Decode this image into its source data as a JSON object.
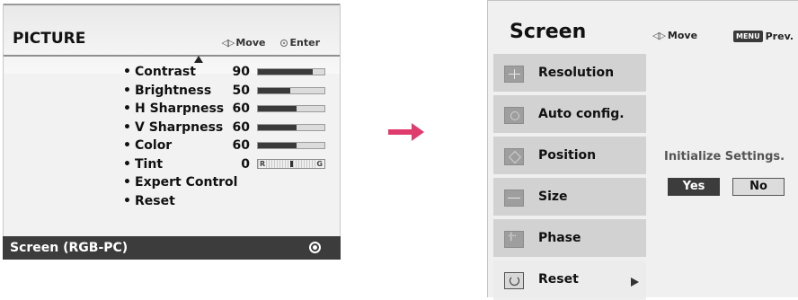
{
  "picture_menu": {
    "title": "PICTURE",
    "move_label": "Move",
    "enter_label": "Enter",
    "items": [
      {
        "label": "Contrast",
        "value": "90",
        "level": 0.82,
        "kind": "bar"
      },
      {
        "label": "Brightness",
        "value": "50",
        "level": 0.48,
        "kind": "bar"
      },
      {
        "label": "H Sharpness",
        "value": "60",
        "level": 0.58,
        "kind": "bar"
      },
      {
        "label": "V Sharpness",
        "value": "60",
        "level": 0.58,
        "kind": "bar"
      },
      {
        "label": "Color",
        "value": "60",
        "level": 0.58,
        "kind": "bar"
      },
      {
        "label": "Tint",
        "value": "0",
        "kind": "tint",
        "left_mark": "R",
        "right_mark": "G"
      },
      {
        "label": "Expert Control",
        "value": "",
        "kind": "none"
      },
      {
        "label": "Reset",
        "value": "",
        "kind": "none"
      }
    ],
    "bullet": "•",
    "footer_label": "Screen (RGB-PC)"
  },
  "screen_menu": {
    "title": "Screen",
    "move_label": "Move",
    "menu_key": "MENU",
    "prev_label": "Prev.",
    "items": [
      {
        "label": "Resolution",
        "icon": "resolution-icon"
      },
      {
        "label": "Auto config.",
        "icon": "auto-config-icon"
      },
      {
        "label": "Position",
        "icon": "position-icon"
      },
      {
        "label": "Size",
        "icon": "size-icon"
      },
      {
        "label": "Phase",
        "icon": "phase-icon"
      },
      {
        "label": "Reset",
        "icon": "reset-icon",
        "active": true
      }
    ],
    "dialog_text": "Initialize Settings.",
    "yes_label": "Yes",
    "no_label": "No"
  },
  "colors": {
    "arrow": "#e03b6d",
    "footer_bg": "#3c3c3c",
    "bar_fill": "#3a3a3a"
  }
}
